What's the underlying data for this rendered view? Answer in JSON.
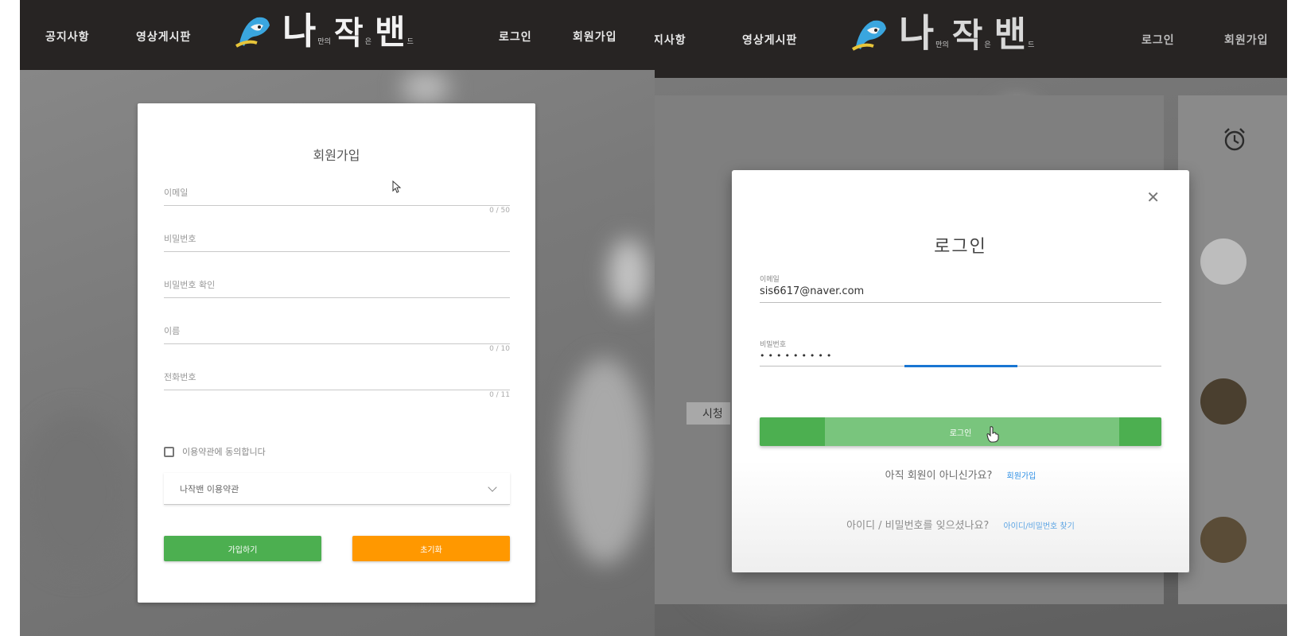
{
  "left": {
    "nav": {
      "notice": "공지사항",
      "video_board": "영상게시판",
      "login": "로그인",
      "signup": "회원가입"
    },
    "logo": {
      "char1": "나",
      "small1": "만의",
      "char2": "작",
      "small2": "은",
      "char3": "밴",
      "small3": "드"
    },
    "signup_form": {
      "title": "회원가입",
      "fields": [
        {
          "label": "이메일",
          "counter": "0 / 50"
        },
        {
          "label": "비밀번호",
          "counter": ""
        },
        {
          "label": "비밀번호 확인",
          "counter": ""
        },
        {
          "label": "이름",
          "counter": "0 / 10"
        },
        {
          "label": "전화번호",
          "counter": "0 / 11"
        }
      ],
      "agree_label": "이용약관에 동의합니다",
      "terms_select_value": "나작밴 이용약관",
      "submit_label": "가입하기",
      "reset_label": "초기화"
    }
  },
  "right": {
    "nav": {
      "notice": "지사항",
      "video_board": "영상게시판",
      "login": "로그인",
      "signup": "회원가입"
    },
    "logo": {
      "char1": "나",
      "small1": "만의",
      "char2": "작",
      "small2": "은",
      "char3": "밴",
      "small3": "드"
    },
    "side_label": "시청",
    "login_dialog": {
      "title": "로그인",
      "email_label": "이메일",
      "email_value": "sis6617@naver.com",
      "password_label": "비밀번호",
      "password_value": "•••••••••",
      "login_button": "로그인",
      "no_account_text": "아직 회원이 아니신가요?",
      "signup_link": "회원가입",
      "forgot_text": "아이디 / 비밀번호를 잊으셨나요?",
      "find_link": "아이디/비밀번호 찾기"
    }
  },
  "colors": {
    "navbar": "#272423",
    "green": "#4caf50",
    "orange": "#ff9800",
    "link": "#1e88e5",
    "focus": "#1976d2"
  },
  "icons": [
    "close-icon",
    "alarm-clock-icon",
    "checkbox-icon",
    "chevron-down-icon",
    "pointer-cursor-icon",
    "logo-mascot-icon"
  ]
}
